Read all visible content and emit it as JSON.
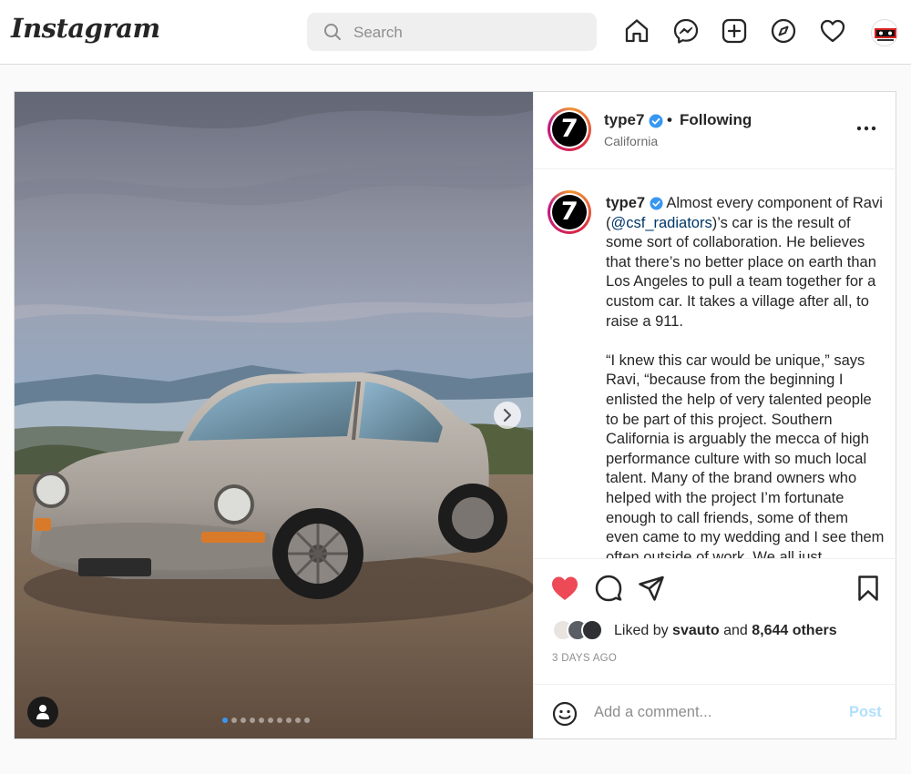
{
  "nav": {
    "logo_text": "Instagram",
    "search_placeholder": "Search",
    "icons": [
      "home-icon",
      "messenger-icon",
      "new-post-icon",
      "explore-icon",
      "activity-heart-icon",
      "profile-avatar"
    ]
  },
  "post": {
    "author": "type7",
    "follow_status": "Following",
    "separator": "•",
    "location": "California",
    "avatar_glyph": "7",
    "carousel": {
      "slide_count": 10,
      "active_index": 0
    },
    "caption": {
      "user": "type7",
      "p1_before": " Almost every component of Ravi (",
      "mention": "@csf_radiators",
      "p1_after": ")’s car is the result of some sort of collaboration. He believes that there’s no better place on earth than Los Angeles to pull a team together for a custom car. It takes a village after all, to raise a 911.",
      "p2": "“I knew this car would be unique,” says Ravi, “because from the beginning I enlisted the help of very talented people to be part of this project. Southern California is arguably the mecca of high performance culture with so much local talent. Many of the brand owners who helped with the project I’m fortunate enough to call friends, some of them even came to my wedding and I see them often outside of work. We all just"
    },
    "likes": {
      "prefix": "Liked by ",
      "liker": "svauto",
      "middle": " and ",
      "others": "8,644 others"
    },
    "time_ago": "3 DAYS AGO",
    "comment_placeholder": "Add a comment...",
    "post_button": "Post",
    "colors": {
      "like_red": "#ed4956",
      "verified_blue": "#3897f0",
      "post_disabled": "#b2dffc"
    }
  }
}
